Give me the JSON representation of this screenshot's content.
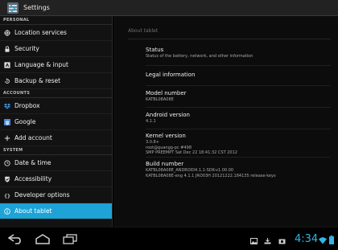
{
  "actionbar": {
    "title": "Settings"
  },
  "sidebar": {
    "sections": [
      {
        "header": "PERSONAL",
        "items": [
          {
            "label": "Location services",
            "icon": "location-icon"
          },
          {
            "label": "Security",
            "icon": "lock-icon"
          },
          {
            "label": "Language & input",
            "icon": "language-icon"
          },
          {
            "label": "Backup & reset",
            "icon": "backup-icon"
          }
        ]
      },
      {
        "header": "ACCOUNTS",
        "items": [
          {
            "label": "Dropbox",
            "icon": "dropbox-icon"
          },
          {
            "label": "Google",
            "icon": "google-icon"
          },
          {
            "label": "Add account",
            "icon": "plus-icon"
          }
        ]
      },
      {
        "header": "SYSTEM",
        "items": [
          {
            "label": "Date & time",
            "icon": "clock-icon"
          },
          {
            "label": "Accessibility",
            "icon": "accessibility-icon"
          },
          {
            "label": "Developer options",
            "icon": "braces-icon"
          },
          {
            "label": "About tablet",
            "icon": "info-icon",
            "selected": true
          }
        ]
      }
    ]
  },
  "content": {
    "heading": "About tablet",
    "prefs": [
      {
        "title": "Status",
        "lines": [
          "Status of the battery, network, and other information"
        ]
      },
      {
        "title": "Legal information",
        "lines": []
      },
      {
        "title": "Model number",
        "lines": [
          "KATBL08A08E"
        ]
      },
      {
        "title": "Android version",
        "lines": [
          "4.1.1"
        ]
      },
      {
        "title": "Kernel version",
        "lines": [
          "3.0.8+",
          "root@guangg-pc #498",
          "SMP PREEMPT Sat Dec 22 18:41:32 CST 2012"
        ]
      },
      {
        "title": "Build number",
        "lines": [
          "KATBL08A08E_ANDROID4.1.1-SDK-v1.00.00",
          "KATBL08A08E-eng 4.1.1 JRO03H 20121222.184135 release-keys"
        ]
      }
    ]
  },
  "statusbar": {
    "time": "4:34"
  },
  "colors": {
    "accent": "#1da3d6",
    "clock": "#33b5e5"
  }
}
